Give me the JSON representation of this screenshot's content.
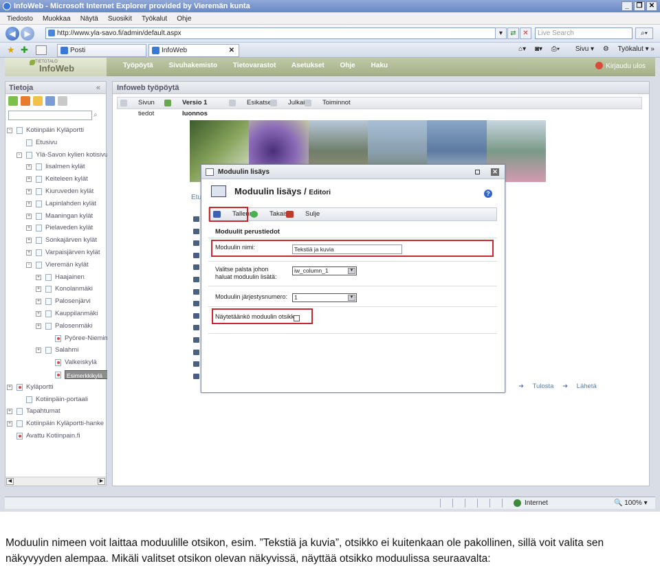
{
  "browser": {
    "title": "InfoWeb - Microsoft Internet Explorer provided by Vieremän kunta",
    "menu": [
      "Tiedosto",
      "Muokkaa",
      "Näytä",
      "Suosikit",
      "Työkalut",
      "Ohje"
    ],
    "address": "http://www.yla-savo.fi/admin/default.aspx",
    "search_placeholder": "Live Search",
    "tabs": [
      "Posti",
      "InfoWeb"
    ],
    "commands": [
      "Sivu",
      "Työkalut"
    ],
    "status_zone": "Internet",
    "zoom": "100%"
  },
  "app": {
    "logo_small": "TIETOTALO",
    "logo": "InfoWeb",
    "nav": [
      "Työpöytä",
      "Sivuhakemisto",
      "Tietovarastot",
      "Asetukset",
      "Ohje",
      "Haku"
    ],
    "logout": "Kirjaudu ulos"
  },
  "left_panel": {
    "title": "Tietoja",
    "tree": [
      {
        "label": "Kotiinpäin Kyläportti",
        "level": 0,
        "pm": "-",
        "red": false
      },
      {
        "label": "Etusivu",
        "level": 1,
        "pm": "",
        "red": false
      },
      {
        "label": "Ylä-Savon kylien kotisivut",
        "level": 1,
        "pm": "-",
        "red": false
      },
      {
        "label": "Iisalmen kylät",
        "level": 2,
        "pm": "+",
        "red": false
      },
      {
        "label": "Keiteleen kylät",
        "level": 2,
        "pm": "+",
        "red": false
      },
      {
        "label": "Kiuruveden kylät",
        "level": 2,
        "pm": "+",
        "red": false
      },
      {
        "label": "Lapinlahden kylät",
        "level": 2,
        "pm": "+",
        "red": false
      },
      {
        "label": "Maaningan kylät",
        "level": 2,
        "pm": "+",
        "red": false
      },
      {
        "label": "Pielaveden kylät",
        "level": 2,
        "pm": "+",
        "red": false
      },
      {
        "label": "Sonkajärven kylät",
        "level": 2,
        "pm": "+",
        "red": false
      },
      {
        "label": "Varpaisjärven kylät",
        "level": 2,
        "pm": "+",
        "red": false
      },
      {
        "label": "Vieremän kylät",
        "level": 2,
        "pm": "-",
        "red": false
      },
      {
        "label": "Haajainen",
        "level": 3,
        "pm": "+",
        "red": false
      },
      {
        "label": "Konolanmäki",
        "level": 3,
        "pm": "+",
        "red": false
      },
      {
        "label": "Palosenjärvi",
        "level": 3,
        "pm": "+",
        "red": false
      },
      {
        "label": "Kauppilanmäki",
        "level": 3,
        "pm": "+",
        "red": false
      },
      {
        "label": "Palosenmäki",
        "level": 3,
        "pm": "+",
        "red": false
      },
      {
        "label": "Pyöree-Nieminen",
        "level": 4,
        "pm": "",
        "red": true
      },
      {
        "label": "Salahmi",
        "level": 3,
        "pm": "+",
        "red": false
      },
      {
        "label": "Valkeiskylä",
        "level": 4,
        "pm": "",
        "red": true
      },
      {
        "label": "Esimerkkikylä",
        "level": 4,
        "pm": "",
        "red": true,
        "selected": true
      },
      {
        "label": "Kyläportti",
        "level": 0,
        "pm": "+",
        "red": true
      },
      {
        "label": "Kotiinpäin-portaali",
        "level": 1,
        "pm": "",
        "red": false
      },
      {
        "label": "Tapahtumat",
        "level": 0,
        "pm": "+",
        "red": false
      },
      {
        "label": "Kotiinpäin Kyläportti-hanke",
        "level": 0,
        "pm": "+",
        "red": false
      },
      {
        "label": "Avattu Kotiinpain.fi",
        "level": 0,
        "pm": "",
        "red": true
      }
    ]
  },
  "main_panel": {
    "title": "Infoweb työpöytä",
    "toolbar": [
      "Sivun tiedot",
      "Versio 1 luonnos",
      "Esikatselu",
      "Julkaise",
      "Toiminnot"
    ],
    "etu": "Etu",
    "bottom_links": [
      "Tulosta",
      "Lähetä"
    ]
  },
  "dialog": {
    "title": "Moduulin lisäys",
    "heading": "Moduulin lisäys",
    "heading_sub": "Editori",
    "buttons": [
      "Tallenna",
      "Takaisin",
      "Sulje"
    ],
    "section": "Moduulit perustiedot",
    "name_label": "Moduulin nimi:",
    "name_value": "Tekstiä ja kuvia",
    "column_label": "Valitse palsta johon haluat moduulin lisätä:",
    "column_value": "iw_column_1",
    "order_label": "Moduulin järjestysnumero:",
    "order_value": "1",
    "show_title_label": "Näytetäänkö moduulin otsikko:"
  },
  "caption": "Moduulin nimeen voit laittaa moduulille otsikon, esim. ”Tekstiä ja kuvia”, otsikko ei kuitenkaan ole pakollinen, sillä voit valita sen näkyvyyden alempaa. Mikäli valitset otsikon olevan näkyvissä, näyttää otsikko moduulissa seuraavalta:"
}
